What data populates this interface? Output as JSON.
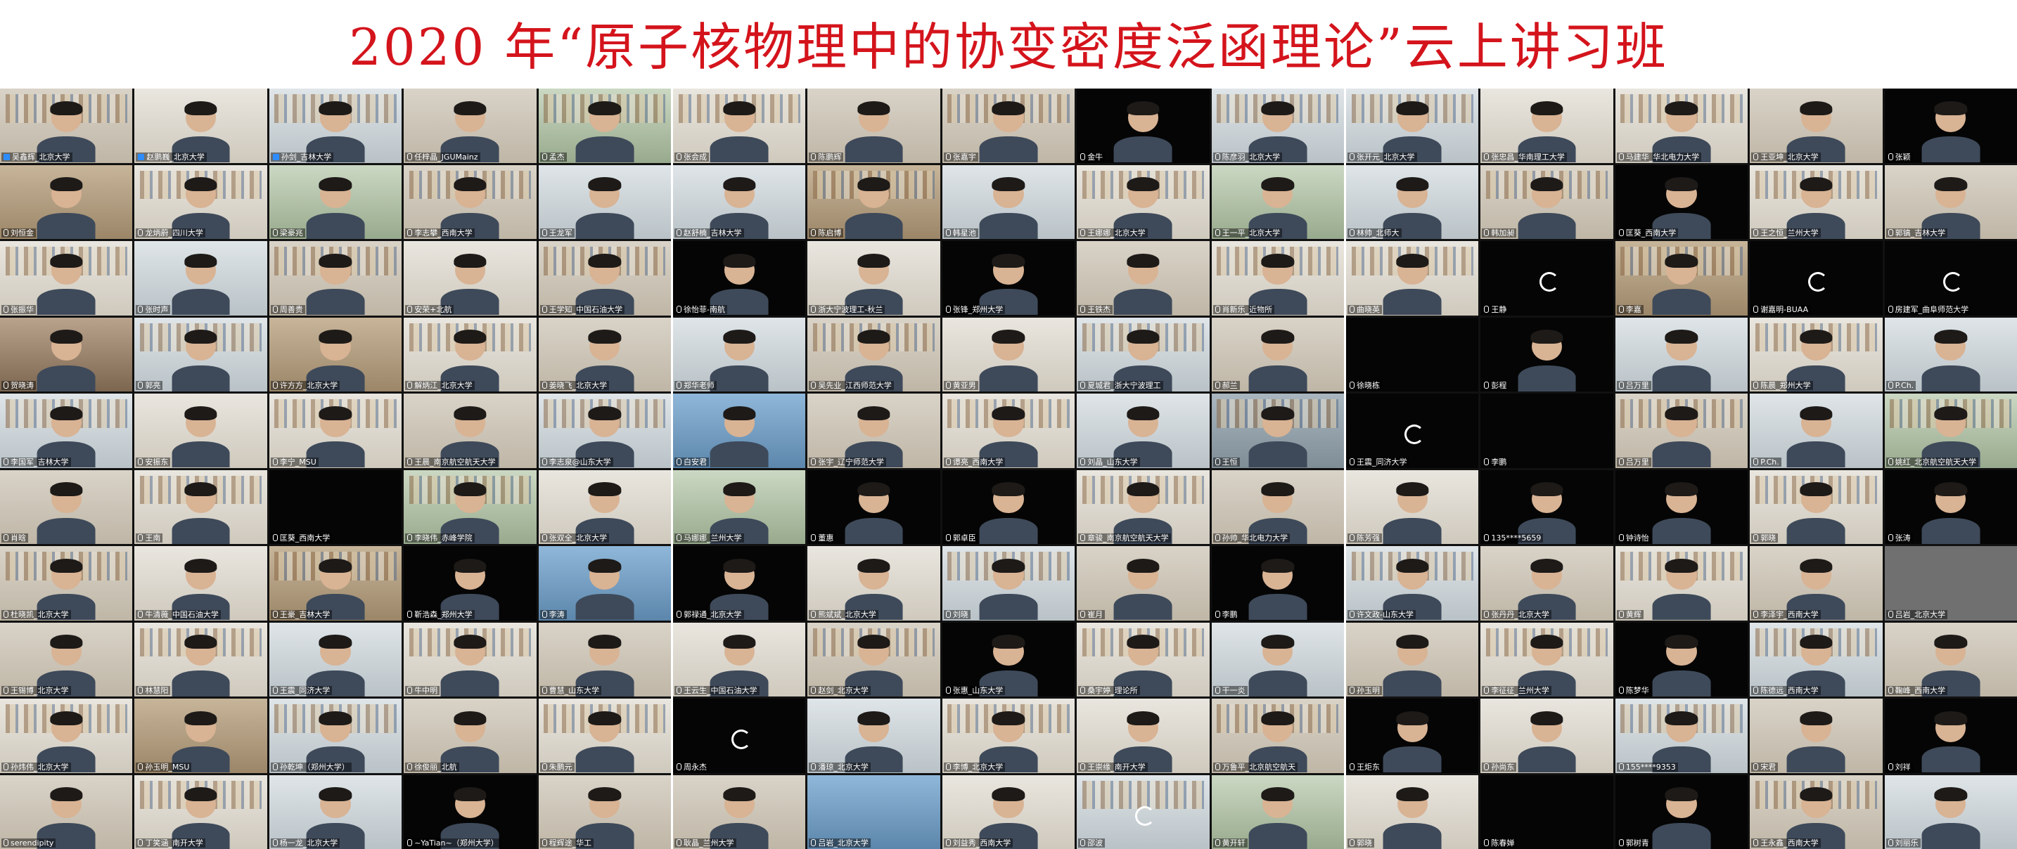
{
  "title": "2020 年“原子核物理中的协变密度泛函理论”云上讲习班",
  "colors": {
    "title": "#d4141c"
  },
  "panels": [
    {
      "cols": 5,
      "tiles": [
        {
          "name": "吴鑫辉_北京大学",
          "bg": "bg-a",
          "person": true
        },
        {
          "name": "赵鹏巍_北京大学",
          "bg": "bg-b",
          "person": true
        },
        {
          "name": "孙剑_吉林大学",
          "bg": "bg-e",
          "person": true
        },
        {
          "name": "任梓晶_JGUMainz",
          "bg": "bg-a",
          "person": true
        },
        {
          "name": "孟杰",
          "bg": "bg-f",
          "person": true
        },
        {
          "name": "刘恒金",
          "bg": "bg-d",
          "person": true
        },
        {
          "name": "龙炳蔚_四川大学",
          "bg": "bg-b",
          "person": true
        },
        {
          "name": "梁豪兆",
          "bg": "bg-f",
          "person": true
        },
        {
          "name": "李志攀_西南大学",
          "bg": "bg-a",
          "person": true
        },
        {
          "name": "王龙军",
          "bg": "bg-e",
          "person": true
        },
        {
          "name": "张振华",
          "bg": "bg-b",
          "person": true
        },
        {
          "name": "张时声",
          "bg": "bg-e",
          "person": true
        },
        {
          "name": "周善贵",
          "bg": "bg-a",
          "person": true
        },
        {
          "name": "安荣+北航",
          "bg": "bg-b",
          "person": true
        },
        {
          "name": "王学知_中国石油大学",
          "bg": "bg-a",
          "person": true
        },
        {
          "name": "贺晓涛",
          "bg": "bg-g",
          "person": true
        },
        {
          "name": "郭亮",
          "bg": "bg-e",
          "person": true
        },
        {
          "name": "许方方_北京大学",
          "bg": "bg-d",
          "person": true
        },
        {
          "name": "解炳江_北京大学",
          "bg": "bg-b",
          "person": true
        },
        {
          "name": "姜晓飞_北京大学",
          "bg": "bg-a",
          "person": true
        },
        {
          "name": "李国军_吉林大学",
          "bg": "bg-e",
          "person": true
        },
        {
          "name": "安振东",
          "bg": "bg-b",
          "person": true
        },
        {
          "name": "李宁_MSU",
          "bg": "bg-b",
          "person": true
        },
        {
          "name": "王晨_南京航空航天大学",
          "bg": "bg-a",
          "person": true
        },
        {
          "name": "李志泉@山东大学",
          "bg": "bg-e",
          "person": true
        },
        {
          "name": "肖晗",
          "bg": "bg-a",
          "person": true
        },
        {
          "name": "王南",
          "bg": "bg-b",
          "person": true
        },
        {
          "name": "匡葵_西南大学",
          "bg": "bg-black",
          "person": false
        },
        {
          "name": "李晓伟_赤峰学院",
          "bg": "bg-f",
          "person": true
        },
        {
          "name": "张双全_北京大学",
          "bg": "bg-b",
          "person": true
        },
        {
          "name": "杜晓凯_北京大学",
          "bg": "bg-a",
          "person": true
        },
        {
          "name": "牛清薇_中国石油大学",
          "bg": "bg-b",
          "person": true
        },
        {
          "name": "王豪_吉林大学",
          "bg": "bg-d",
          "person": true
        },
        {
          "name": "靳浩森_郑州大学",
          "bg": "bg-black",
          "person": true
        },
        {
          "name": "李涛",
          "bg": "bg-h",
          "person": true
        },
        {
          "name": "王锡博_北京大学",
          "bg": "bg-a",
          "person": true
        },
        {
          "name": "林慧阳",
          "bg": "bg-b",
          "person": true
        },
        {
          "name": "王震_同济大学",
          "bg": "bg-e",
          "person": true
        },
        {
          "name": "牛中明",
          "bg": "bg-b",
          "person": true
        },
        {
          "name": "曹慧_山东大学",
          "bg": "bg-a",
          "person": true
        },
        {
          "name": "孙炜伟_北京大学",
          "bg": "bg-b",
          "person": true
        },
        {
          "name": "孙玉明_MSU",
          "bg": "bg-d",
          "person": true
        },
        {
          "name": "孙乾坤（郑州大学）",
          "bg": "bg-e",
          "person": true
        },
        {
          "name": "徐俊丽_北航",
          "bg": "bg-a",
          "person": true
        },
        {
          "name": "朱鹏元",
          "bg": "bg-b",
          "person": true
        },
        {
          "name": "serendipity",
          "bg": "bg-a",
          "person": true
        },
        {
          "name": "丁笑涵_南开大学",
          "bg": "bg-b",
          "person": true
        },
        {
          "name": "杨一龙_北京大学",
          "bg": "bg-e",
          "person": true
        },
        {
          "name": "~YaTian~（郑州大学）",
          "bg": "bg-black",
          "person": true
        },
        {
          "name": "程辉途_华工",
          "bg": "bg-a",
          "person": true
        }
      ]
    },
    {
      "cols": 5,
      "tiles": [
        {
          "name": "张会成",
          "bg": "bg-b",
          "person": true
        },
        {
          "name": "陈鹏辉",
          "bg": "bg-a",
          "person": true
        },
        {
          "name": "张嘉宇",
          "bg": "bg-a",
          "person": true
        },
        {
          "name": "金牛",
          "bg": "bg-black",
          "person": true
        },
        {
          "name": "陈彦羽_北京大学",
          "bg": "bg-e",
          "person": true
        },
        {
          "name": "赵舒楠_吉林大学",
          "bg": "bg-e",
          "person": true
        },
        {
          "name": "陈启博",
          "bg": "bg-d",
          "person": true
        },
        {
          "name": "韩星池",
          "bg": "bg-e",
          "person": true
        },
        {
          "name": "王娜娜_北京大学",
          "bg": "bg-b",
          "person": true
        },
        {
          "name": "王一平_北京大学",
          "bg": "bg-f",
          "person": true
        },
        {
          "name": "徐怡菲-南航",
          "bg": "bg-black",
          "person": true
        },
        {
          "name": "浙大宁波理工-秋兰",
          "bg": "bg-b",
          "person": true
        },
        {
          "name": "张锋_郑州大学",
          "bg": "bg-black",
          "person": true
        },
        {
          "name": "王铁杰",
          "bg": "bg-a",
          "person": true
        },
        {
          "name": "肖新乐_近物所",
          "bg": "bg-b",
          "person": true
        },
        {
          "name": "郑华老师",
          "bg": "bg-e",
          "person": true
        },
        {
          "name": "吴先业_江西师范大学",
          "bg": "bg-a",
          "person": true
        },
        {
          "name": "黄亚男",
          "bg": "bg-b",
          "person": true
        },
        {
          "name": "夏城君_浙大宁波理工",
          "bg": "bg-e",
          "person": true
        },
        {
          "name": "郝兰",
          "bg": "bg-a",
          "person": true
        },
        {
          "name": "白安君",
          "bg": "bg-h",
          "person": true
        },
        {
          "name": "张宇_辽宁师范大学",
          "bg": "bg-a",
          "person": true
        },
        {
          "name": "谭亮_西南大学",
          "bg": "bg-b",
          "person": true
        },
        {
          "name": "刘晶_山东大学",
          "bg": "bg-e",
          "person": true
        },
        {
          "name": "王恒",
          "bg": "bg-c",
          "person": true
        },
        {
          "name": "马娜娜_兰州大学",
          "bg": "bg-f",
          "person": true
        },
        {
          "name": "董惠",
          "bg": "bg-black",
          "person": true
        },
        {
          "name": "郭卓臣",
          "bg": "bg-black",
          "person": true
        },
        {
          "name": "章骏_南京航空航天大学",
          "bg": "bg-b",
          "person": true
        },
        {
          "name": "孙帅_华北电力大学",
          "bg": "bg-a",
          "person": true
        },
        {
          "name": "郭禄通_北京大学",
          "bg": "bg-black",
          "person": true
        },
        {
          "name": "熊斌斌_北京大学",
          "bg": "bg-b",
          "person": true
        },
        {
          "name": "刘晓",
          "bg": "bg-e",
          "person": true
        },
        {
          "name": "崔月",
          "bg": "bg-a",
          "person": true
        },
        {
          "name": "李鹏",
          "bg": "bg-black",
          "person": true
        },
        {
          "name": "王云生_中国石油大学",
          "bg": "bg-b",
          "person": true
        },
        {
          "name": "赵剑_北京大学",
          "bg": "bg-a",
          "person": true
        },
        {
          "name": "张惠_山东大学",
          "bg": "bg-black",
          "person": true
        },
        {
          "name": "桑宇婷_理论所",
          "bg": "bg-b",
          "person": true
        },
        {
          "name": "干一炎",
          "bg": "bg-e",
          "person": true
        },
        {
          "name": "周永杰",
          "bg": "bg-black",
          "person": false,
          "loading": true
        },
        {
          "name": "潘琼_北京大学",
          "bg": "bg-e",
          "person": true
        },
        {
          "name": "李博_北京大学",
          "bg": "bg-b",
          "person": true
        },
        {
          "name": "王崇缘_南开大学",
          "bg": "bg-b",
          "person": true
        },
        {
          "name": "万鲁平_北京航空航天",
          "bg": "bg-a",
          "person": true
        },
        {
          "name": "耿晶_兰州大学",
          "bg": "bg-a",
          "person": true
        },
        {
          "name": "吕岩_北京大学",
          "bg": "bg-h",
          "person": false
        },
        {
          "name": "刘益秀_西南大学",
          "bg": "bg-b",
          "person": true
        },
        {
          "name": "邵波",
          "bg": "bg-e",
          "person": false,
          "loading": true
        },
        {
          "name": "黄开轩",
          "bg": "bg-f",
          "person": true
        }
      ]
    },
    {
      "cols": 5,
      "tiles": [
        {
          "name": "张开元_北京大学",
          "bg": "bg-e",
          "person": true
        },
        {
          "name": "张忠昌_华南理工大学",
          "bg": "bg-b",
          "person": true
        },
        {
          "name": "马建华_华北电力大学",
          "bg": "bg-b",
          "person": true
        },
        {
          "name": "王亚坤_北京大学",
          "bg": "bg-a",
          "person": true
        },
        {
          "name": "张颖",
          "bg": "bg-black",
          "person": true
        },
        {
          "name": "林帅_北师大",
          "bg": "bg-e",
          "person": true
        },
        {
          "name": "韩加昶",
          "bg": "bg-a",
          "person": true
        },
        {
          "name": "匡葵_西南大学",
          "bg": "bg-black",
          "person": true
        },
        {
          "name": "王之恒_兰州大学",
          "bg": "bg-b",
          "person": true
        },
        {
          "name": "郭镐_吉林大学",
          "bg": "bg-a",
          "person": true
        },
        {
          "name": "曲晓英",
          "bg": "bg-b",
          "person": true
        },
        {
          "name": "王静",
          "bg": "bg-black",
          "person": false,
          "loading": true
        },
        {
          "name": "李嘉",
          "bg": "bg-d",
          "person": true
        },
        {
          "name": "谢嘉明-BUAA",
          "bg": "bg-black",
          "person": false,
          "loading": true
        },
        {
          "name": "房建军_曲阜师范大学",
          "bg": "bg-black",
          "person": false,
          "loading": true
        },
        {
          "name": "徐晓栋",
          "bg": "bg-black",
          "person": false
        },
        {
          "name": "彭程",
          "bg": "bg-black",
          "person": true
        },
        {
          "name": "吕万里",
          "bg": "bg-e",
          "person": true
        },
        {
          "name": "陈晨_郑州大学",
          "bg": "bg-b",
          "person": true
        },
        {
          "name": "P.Ch.",
          "bg": "bg-e",
          "person": true
        },
        {
          "name": "王震_同济大学",
          "bg": "bg-black",
          "person": false,
          "loading": true
        },
        {
          "name": "李鹏",
          "bg": "bg-black",
          "person": false
        },
        {
          "name": "吕万里",
          "bg": "bg-a",
          "person": true
        },
        {
          "name": "P.Ch.",
          "bg": "bg-e",
          "person": true
        },
        {
          "name": "姚红_北京航空航天大学",
          "bg": "bg-f",
          "person": true
        },
        {
          "name": "陈芳强",
          "bg": "bg-b",
          "person": true
        },
        {
          "name": "135****5659",
          "bg": "bg-black",
          "person": true
        },
        {
          "name": "钟诗怡",
          "bg": "bg-black",
          "person": true
        },
        {
          "name": "郭晓",
          "bg": "bg-b",
          "person": true
        },
        {
          "name": "张涛",
          "bg": "bg-black",
          "person": true
        },
        {
          "name": "许文政-山东大学",
          "bg": "bg-e",
          "person": true
        },
        {
          "name": "张丹丹_北京大学",
          "bg": "bg-a",
          "person": true
        },
        {
          "name": "黄辉",
          "bg": "bg-b",
          "person": true
        },
        {
          "name": "李泽宇_西南大学",
          "bg": "bg-a",
          "person": true
        },
        {
          "name": "吕岩_北京大学",
          "bg": "bg-gray",
          "person": false
        },
        {
          "name": "孙玉明",
          "bg": "bg-a",
          "person": true
        },
        {
          "name": "李征征_兰州大学",
          "bg": "bg-b",
          "person": true
        },
        {
          "name": "陈梦华",
          "bg": "bg-black",
          "person": true
        },
        {
          "name": "陈德远_西南大学",
          "bg": "bg-e",
          "person": true
        },
        {
          "name": "鞠峰_西南大学",
          "bg": "bg-a",
          "person": true
        },
        {
          "name": "王炬东",
          "bg": "bg-black",
          "person": true
        },
        {
          "name": "孙尚东",
          "bg": "bg-b",
          "person": true
        },
        {
          "name": "155****9353",
          "bg": "bg-e",
          "person": true
        },
        {
          "name": "宋君",
          "bg": "bg-a",
          "person": true
        },
        {
          "name": "刘祥",
          "bg": "bg-black",
          "person": true
        },
        {
          "name": "郭晓",
          "bg": "bg-b",
          "person": true
        },
        {
          "name": "陈春婵",
          "bg": "bg-black",
          "person": false
        },
        {
          "name": "郭树青",
          "bg": "bg-black",
          "person": true
        },
        {
          "name": "王永鑫_西南大学",
          "bg": "bg-a",
          "person": true
        },
        {
          "name": "刘丽乐",
          "bg": "bg-e",
          "person": true
        }
      ]
    }
  ]
}
